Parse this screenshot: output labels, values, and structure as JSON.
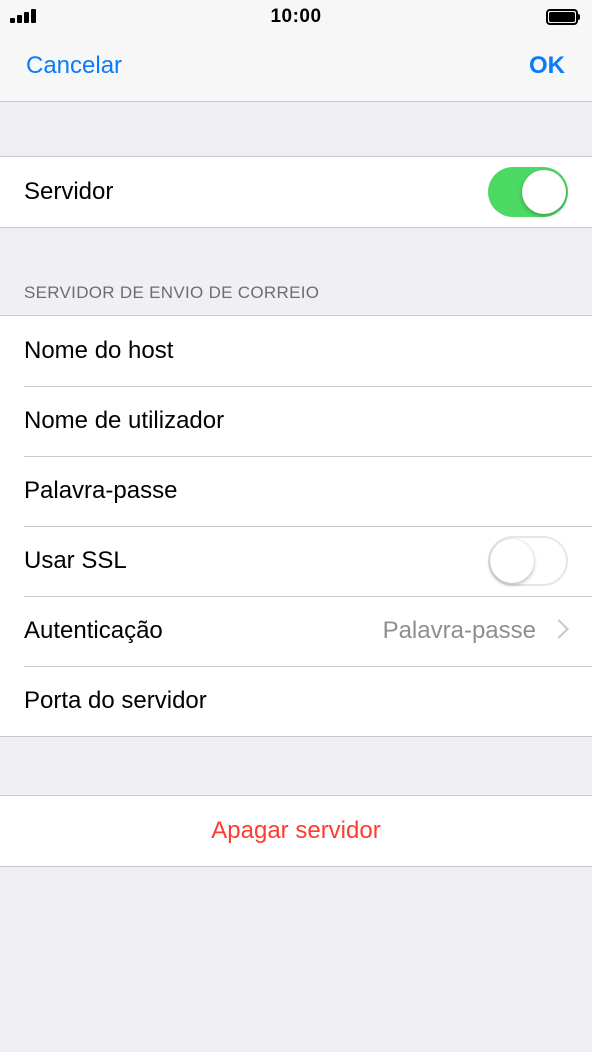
{
  "status_bar": {
    "time": "10:00",
    "signal_icon": "signal-bars-icon",
    "battery_icon": "battery-full-icon"
  },
  "nav": {
    "cancel_label": "Cancelar",
    "ok_label": "OK"
  },
  "server_toggle": {
    "label": "Servidor",
    "state": "on"
  },
  "outgoing_section": {
    "header": "SERVIDOR DE ENVIO DE CORREIO",
    "rows": [
      {
        "label": "Nome do host"
      },
      {
        "label": "Nome de utilizador"
      },
      {
        "label": "Palavra-passe"
      },
      {
        "label": "Usar SSL",
        "state": "off"
      },
      {
        "label": "Autenticação",
        "value": "Palavra-passe"
      },
      {
        "label": "Porta do servidor"
      }
    ]
  },
  "delete_server": {
    "label": "Apagar servidor"
  },
  "colors": {
    "accent": "#0a7aff",
    "toggle_on": "#4cd964",
    "destructive": "#ff3b30",
    "background": "#efeff4"
  }
}
